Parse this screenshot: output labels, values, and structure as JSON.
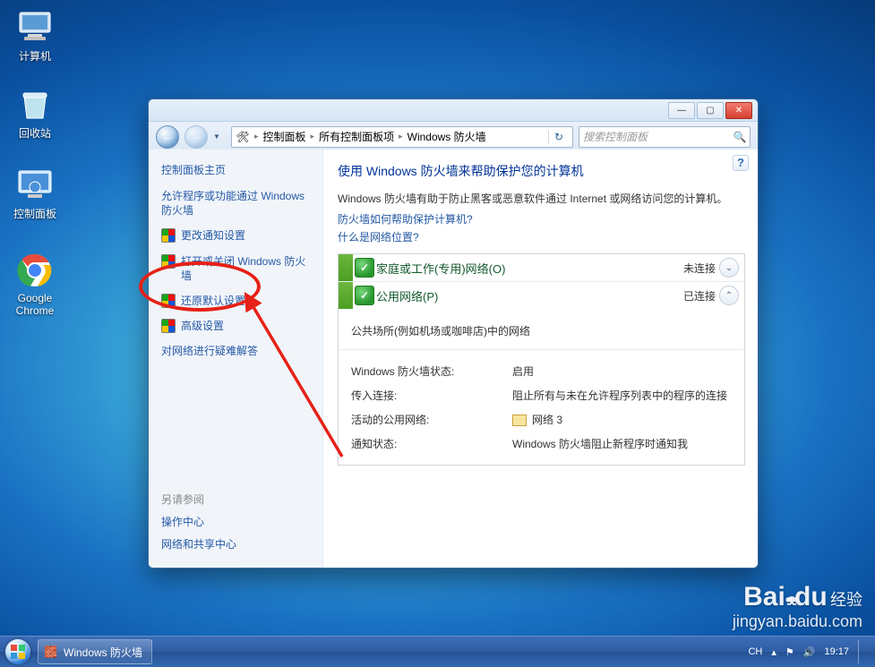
{
  "desktop": {
    "icons": [
      {
        "name": "icon-computer",
        "label": "计算机"
      },
      {
        "name": "icon-recycle",
        "label": "回收站"
      },
      {
        "name": "icon-controlpanel",
        "label": "控制面板"
      },
      {
        "name": "icon-chrome",
        "label": "Google Chrome"
      }
    ]
  },
  "window": {
    "breadcrumb": {
      "root": "控制面板",
      "level1": "所有控制面板项",
      "level2": "Windows 防火墙"
    },
    "search_placeholder": "搜索控制面板",
    "sidebar": {
      "home": "控制面板主页",
      "items": [
        "允许程序或功能通过 Windows 防火墙",
        "更改通知设置",
        "打开或关闭 Windows 防火墙",
        "还原默认设置",
        "高级设置",
        "对网络进行疑难解答"
      ],
      "see_also_title": "另请参阅",
      "see_also": [
        "操作中心",
        "网络和共享中心"
      ]
    },
    "content": {
      "title": "使用 Windows 防火墙来帮助保护您的计算机",
      "desc": "Windows 防火墙有助于防止黑客或恶意软件通过 Internet 或网络访问您的计算机。",
      "link1": "防火墙如何帮助保护计算机?",
      "link2": "什么是网络位置?",
      "sections": [
        {
          "title": "家庭或工作(专用)网络(O)",
          "state": "未连接",
          "expanded": false
        },
        {
          "title": "公用网络(P)",
          "state": "已连接",
          "expanded": true
        }
      ],
      "public_note": "公共场所(例如机场或咖啡店)中的网络",
      "rows": [
        {
          "k": "Windows 防火墙状态:",
          "v": "启用"
        },
        {
          "k": "传入连接:",
          "v": "阻止所有与未在允许程序列表中的程序的连接"
        },
        {
          "k": "活动的公用网络:",
          "v": "网络 3",
          "icon": true
        },
        {
          "k": "通知状态:",
          "v": "Windows 防火墙阻止新程序时通知我"
        }
      ]
    }
  },
  "taskbar": {
    "task_label": "Windows 防火墙",
    "ime": "CH",
    "clock": "19:17"
  },
  "watermark": {
    "brand": "Bai",
    "du": "du",
    "tag": "经验",
    "url": "jingyan.baidu.com"
  }
}
